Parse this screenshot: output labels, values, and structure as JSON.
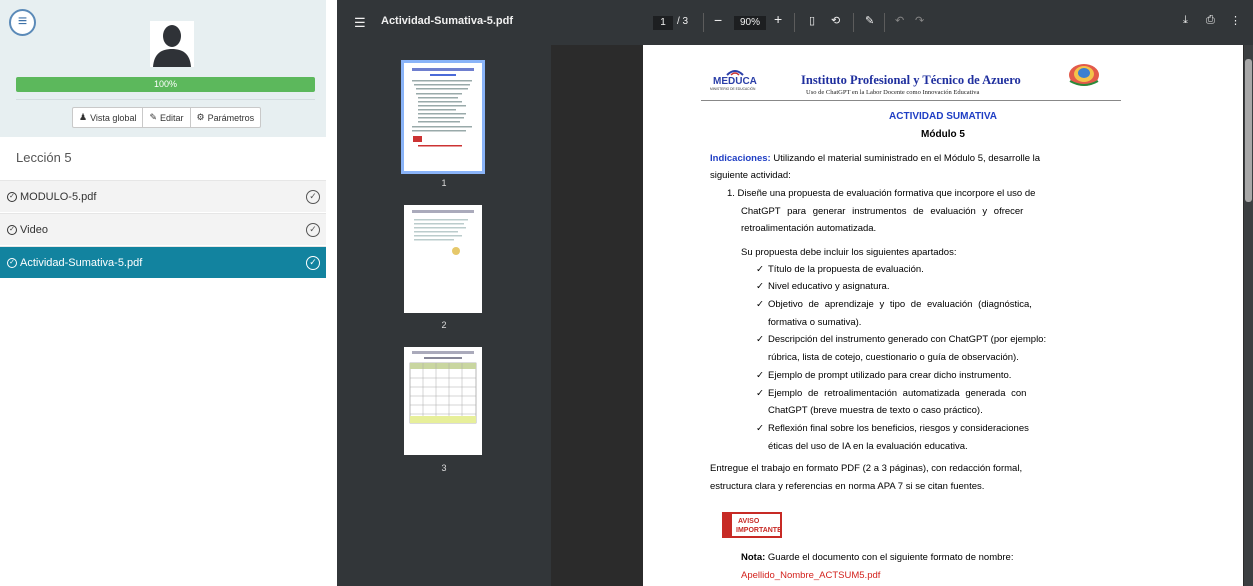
{
  "sidebar": {
    "progress_label": "100%",
    "buttons": [
      {
        "icon": "person-icon",
        "label": "Vista global"
      },
      {
        "icon": "pencil-icon",
        "label": "Editar"
      },
      {
        "icon": "gear-icon",
        "label": "Parámetros"
      }
    ],
    "lesson_title": "Lección 5",
    "items": [
      {
        "label": "MODULO-5.pdf",
        "active": false
      },
      {
        "label": "Video",
        "active": false
      },
      {
        "label": "Actividad-Sumativa-5.pdf",
        "active": true
      }
    ]
  },
  "viewer": {
    "file_name": "Actividad-Sumativa-5.pdf",
    "current_page": "1",
    "total_pages": "/ 3",
    "zoom": "90%",
    "thumbnails": [
      "1",
      "2",
      "3"
    ]
  },
  "document": {
    "logo_text": "MEDUCA",
    "logo_subtext": "MINISTERIO DE EDUCACIÓN",
    "header_title": "Instituto Profesional y Técnico de Azuero",
    "header_sub": "Uso de ChatGPT en la Labor Docente como Innovación Educativa",
    "activity_title": "ACTIVIDAD SUMATIVA",
    "module_title": "Módulo 5",
    "indicaciones_label": "Indicaciones:",
    "indicaciones_line1": " Utilizando el material suministrado en el Módulo 5, desarrolle la",
    "indicaciones_line2": "siguiente actividad:",
    "item1_l1": "1.  Diseñe una propuesta de evaluación formativa que incorpore el uso de",
    "item1_l2": "ChatGPT para generar instrumentos de evaluación y ofrecer",
    "item1_l3": "retroalimentación automatizada.",
    "apartados_intro": "Su propuesta debe incluir los siguientes apartados:",
    "check_mark": "✓",
    "bullets": [
      [
        "Título de la propuesta de evaluación."
      ],
      [
        "Nivel educativo y asignatura."
      ],
      [
        "Objetivo de aprendizaje y tipo de evaluación (diagnóstica,",
        "formativa o sumativa)."
      ],
      [
        "Descripción del instrumento generado con ChatGPT (por ejemplo:",
        "rúbrica, lista de cotejo, cuestionario o guía de observación)."
      ],
      [
        "Ejemplo de prompt utilizado para crear dicho instrumento."
      ],
      [
        "Ejemplo de retroalimentación automatizada generada con",
        "ChatGPT (breve muestra de texto o caso práctico)."
      ],
      [
        "Reflexión final sobre los beneficios, riesgos y consideraciones",
        "éticas del uso de IA en la evaluación educativa."
      ]
    ],
    "entregue_l1": "Entregue el trabajo en formato PDF (2 a 3 páginas), con redacción formal,",
    "entregue_l2": "estructura clara y referencias en norma APA 7 si se citan fuentes.",
    "aviso_l1": "AVISO",
    "aviso_l2": "IMPORTANTE",
    "nota_label": "Nota:",
    "nota_text": " Guarde el documento con el siguiente formato de nombre:",
    "nota_file": "Apellido_Nombre_ACTSUM5.pdf"
  }
}
